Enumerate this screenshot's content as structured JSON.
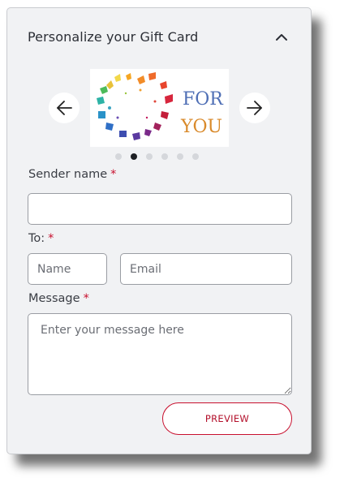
{
  "panel": {
    "title": "Personalize your Gift Card",
    "collapse_icon": "chevron-up-icon"
  },
  "carousel": {
    "prev_icon": "arrow-left-icon",
    "next_icon": "arrow-right-icon",
    "card_text_line1": "FOR",
    "card_text_line2": "YOU",
    "slide_count": 6,
    "active_index": 1
  },
  "form": {
    "sender": {
      "label": "Sender name",
      "required_mark": "*",
      "value": ""
    },
    "to": {
      "label": "To:",
      "required_mark": "*",
      "name_placeholder": "Name",
      "email_placeholder": "Email"
    },
    "message": {
      "label": "Message",
      "required_mark": "*",
      "placeholder": "Enter your message here"
    },
    "preview_label": "PREVIEW"
  },
  "colors": {
    "accent": "#c8102e",
    "panel_bg": "#f1f2f4"
  }
}
